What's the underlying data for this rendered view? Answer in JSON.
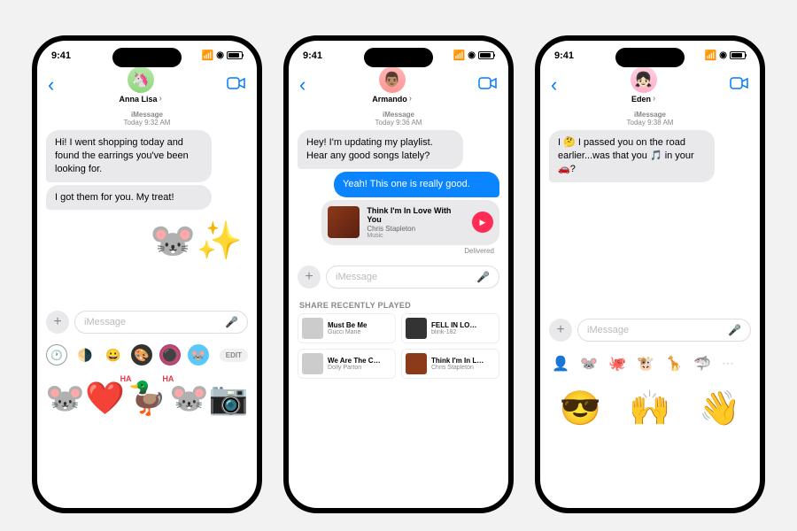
{
  "status": {
    "time": "9:41"
  },
  "phones": [
    {
      "contact": {
        "name": "Anna Lisa",
        "avatar_emoji": "🦄"
      },
      "timestamp": {
        "label": "iMessage",
        "time": "Today 9:32 AM"
      },
      "messages": [
        {
          "dir": "in",
          "text": "Hi! I went shopping today and found the earrings you've been looking for."
        },
        {
          "dir": "in",
          "text": "I got them for you. My treat!"
        }
      ],
      "sticker_sent": "🐭✨",
      "input_placeholder": "iMessage",
      "edit_label": "EDIT",
      "tray_stickers": [
        "🐭❤️",
        "🦆",
        "🐭📷"
      ]
    },
    {
      "contact": {
        "name": "Armando",
        "avatar_emoji": "👨🏽"
      },
      "timestamp": {
        "label": "iMessage",
        "time": "Today 9:36 AM"
      },
      "messages": [
        {
          "dir": "in",
          "text": "Hey! I'm updating my playlist. Hear any good songs lately?"
        },
        {
          "dir": "out",
          "text": "Yeah! This one is really good."
        }
      ],
      "music_card": {
        "title": "Think I'm In Love With You",
        "artist": "Chris Stapleton",
        "source": "Music"
      },
      "delivered": "Delivered",
      "input_placeholder": "iMessage",
      "section_title": "SHARE RECENTLY PLAYED",
      "recently_played": [
        {
          "title": "Must Be Me",
          "artist": "Gucci Mane"
        },
        {
          "title": "FELL IN LO…",
          "artist": "blink-182"
        },
        {
          "title": "We Are The C…",
          "artist": "Dolly Parton"
        },
        {
          "title": "Think I'm In L…",
          "artist": "Chris Stapleton"
        }
      ]
    },
    {
      "contact": {
        "name": "Eden",
        "avatar_emoji": "👧🏻"
      },
      "timestamp": {
        "label": "iMessage",
        "time": "Today 9:38 AM"
      },
      "messages": [
        {
          "dir": "in",
          "text": "I 🤔 I passed you on the road earlier...was that you 🎵 in your 🚗?"
        }
      ],
      "input_placeholder": "iMessage",
      "memoji_tray": [
        "👤",
        "🐭",
        "🐙",
        "🐮",
        "🦒",
        "🦈"
      ],
      "memoji_big": [
        "😎",
        "🙌",
        "👋"
      ]
    }
  ]
}
